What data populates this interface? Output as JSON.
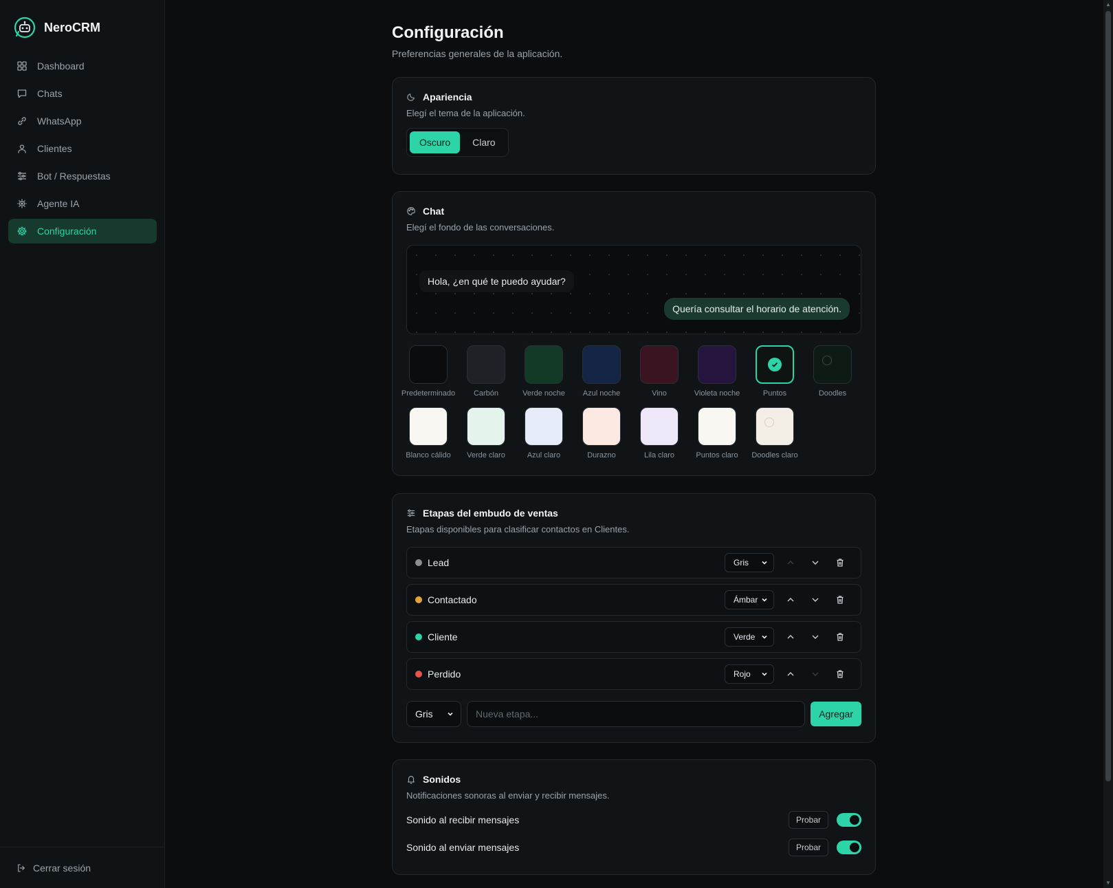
{
  "app": {
    "name": "NeroCRM",
    "accent": "#2dd4a7"
  },
  "sidebar": {
    "items": [
      {
        "label": "Dashboard",
        "icon": "grid-icon"
      },
      {
        "label": "Chats",
        "icon": "message-icon"
      },
      {
        "label": "WhatsApp",
        "icon": "link-icon"
      },
      {
        "label": "Clientes",
        "icon": "user-icon"
      },
      {
        "label": "Bot / Respuestas",
        "icon": "sliders-icon"
      },
      {
        "label": "Agente IA",
        "icon": "cpu-icon"
      },
      {
        "label": "Configuración",
        "icon": "gear-icon",
        "active": true
      }
    ],
    "logout": "Cerrar sesión"
  },
  "page": {
    "title": "Configuración",
    "subtitle": "Preferencias generales de la aplicación."
  },
  "appearance": {
    "title": "Apariencia",
    "desc": "Elegí el tema de la aplicación.",
    "options": [
      "Oscuro",
      "Claro"
    ],
    "selected": "Oscuro"
  },
  "chat": {
    "title": "Chat",
    "desc": "Elegí el fondo de las conversaciones.",
    "preview_in": "Hola, ¿en qué te puedo ayudar?",
    "preview_out": "Quería consultar el horario de atención.",
    "backgrounds": [
      {
        "label": "Predeterminado",
        "color": "#0a0c0e"
      },
      {
        "label": "Carbón",
        "color": "#1e2226"
      },
      {
        "label": "Verde noche",
        "color": "#123a26"
      },
      {
        "label": "Azul noche",
        "color": "#142444"
      },
      {
        "label": "Vino",
        "color": "#3a1420"
      },
      {
        "label": "Violeta noche",
        "color": "#24143e"
      },
      {
        "label": "Puntos",
        "color": "#0e1412",
        "selected": true
      },
      {
        "label": "Doodles",
        "color": "#0e1a14"
      },
      {
        "label": "Blanco cálido",
        "color": "#f8f7f2"
      },
      {
        "label": "Verde claro",
        "color": "#e4f4ec"
      },
      {
        "label": "Azul claro",
        "color": "#e6ecfa"
      },
      {
        "label": "Durazno",
        "color": "#fbe9e2"
      },
      {
        "label": "Lila claro",
        "color": "#efe8fb"
      },
      {
        "label": "Puntos claro",
        "color": "#f8f7f2"
      },
      {
        "label": "Doodles claro",
        "color": "#f3efe6"
      }
    ]
  },
  "stages": {
    "title": "Etapas del embudo de ventas",
    "desc": "Etapas disponibles para clasificar contactos en Clientes.",
    "items": [
      {
        "name": "Lead",
        "color_label": "Gris",
        "color": "#8a8f94"
      },
      {
        "name": "Contactado",
        "color_label": "Ámbar",
        "color": "#e3a33a"
      },
      {
        "name": "Cliente",
        "color_label": "Verde",
        "color": "#2dd4a7"
      },
      {
        "name": "Perdido",
        "color_label": "Rojo",
        "color": "#e5534b"
      }
    ],
    "new_color": "Gris",
    "new_placeholder": "Nueva etapa...",
    "add_label": "Agregar"
  },
  "sounds": {
    "title": "Sonidos",
    "desc": "Notificaciones sonoras al enviar y recibir mensajes.",
    "rows": [
      {
        "label": "Sonido al recibir mensajes",
        "test": "Probar",
        "enabled": true
      },
      {
        "label": "Sonido al enviar mensajes",
        "test": "Probar",
        "enabled": true
      }
    ]
  }
}
